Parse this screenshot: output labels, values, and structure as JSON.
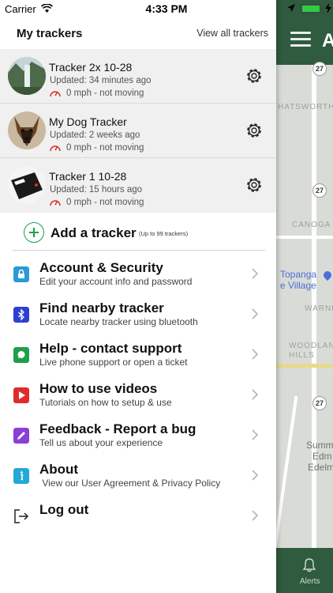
{
  "status_bar": {
    "carrier": "Carrier",
    "time": "4:33 PM"
  },
  "drawer": {
    "title": "My trackers",
    "view_all": "View all trackers",
    "trackers": [
      {
        "name": "Tracker 2x 10-28",
        "updated": "Updated: 34 minutes ago",
        "speed": "0 mph - not moving",
        "avatar": "waterfall-photo"
      },
      {
        "name": "My Dog Tracker",
        "updated": "Updated: 2 weeks ago",
        "speed": "0 mph - not moving",
        "avatar": "dog-photo"
      },
      {
        "name": "Tracker 1 10-28",
        "updated": "Updated: 15 hours ago",
        "speed": "0 mph - not moving",
        "avatar": "tracker-device-photo"
      }
    ],
    "add_tracker": {
      "label": "Add a tracker",
      "note": "(Up to 99 trackers)"
    },
    "menu": [
      {
        "title": "Account & Security",
        "subtitle": "Edit your account info and password",
        "icon": "lock-icon",
        "color": "#2a9ad6"
      },
      {
        "title": "Find nearby tracker",
        "subtitle": "Locate nearby tracker using bluetooth",
        "icon": "bluetooth-icon",
        "color": "#2e3fd4"
      },
      {
        "title": "Help - contact support",
        "subtitle": "Live phone support or open a ticket",
        "icon": "chat-icon",
        "color": "#1f9e4b"
      },
      {
        "title": "How to use videos",
        "subtitle": "Tutorials on how to setup & use",
        "icon": "play-icon",
        "color": "#e02b2b"
      },
      {
        "title": "Feedback - Report a bug",
        "subtitle": "Tell us about your experience",
        "icon": "pencil-icon",
        "color": "#8b3fd6"
      },
      {
        "title": "About",
        "subtitle": " View our User Agreement & Privacy Policy",
        "icon": "info-icon",
        "color": "#25a8d6"
      },
      {
        "title": "Log out",
        "subtitle": "",
        "icon": "logout-icon",
        "color": "#222222"
      }
    ]
  },
  "map": {
    "header_letter": "A",
    "labels": {
      "chatsworth": "HATSWORTH",
      "canoga_park": "CANOGA P",
      "warner": "WARNE",
      "woodland_hills_1": "WOODLAND",
      "woodland_hills_2": "HILLS",
      "topanga_1": "Topanga",
      "topanga_2": "e Village",
      "summit_1": "Summ",
      "summit_2": "Edm",
      "summit_3": "Edelm"
    },
    "shields": [
      "27",
      "27",
      "27"
    ],
    "bottom_tab": "Alerts"
  },
  "colors": {
    "brand_green": "#2f5b3f",
    "accent_green": "#1f9e4b"
  }
}
